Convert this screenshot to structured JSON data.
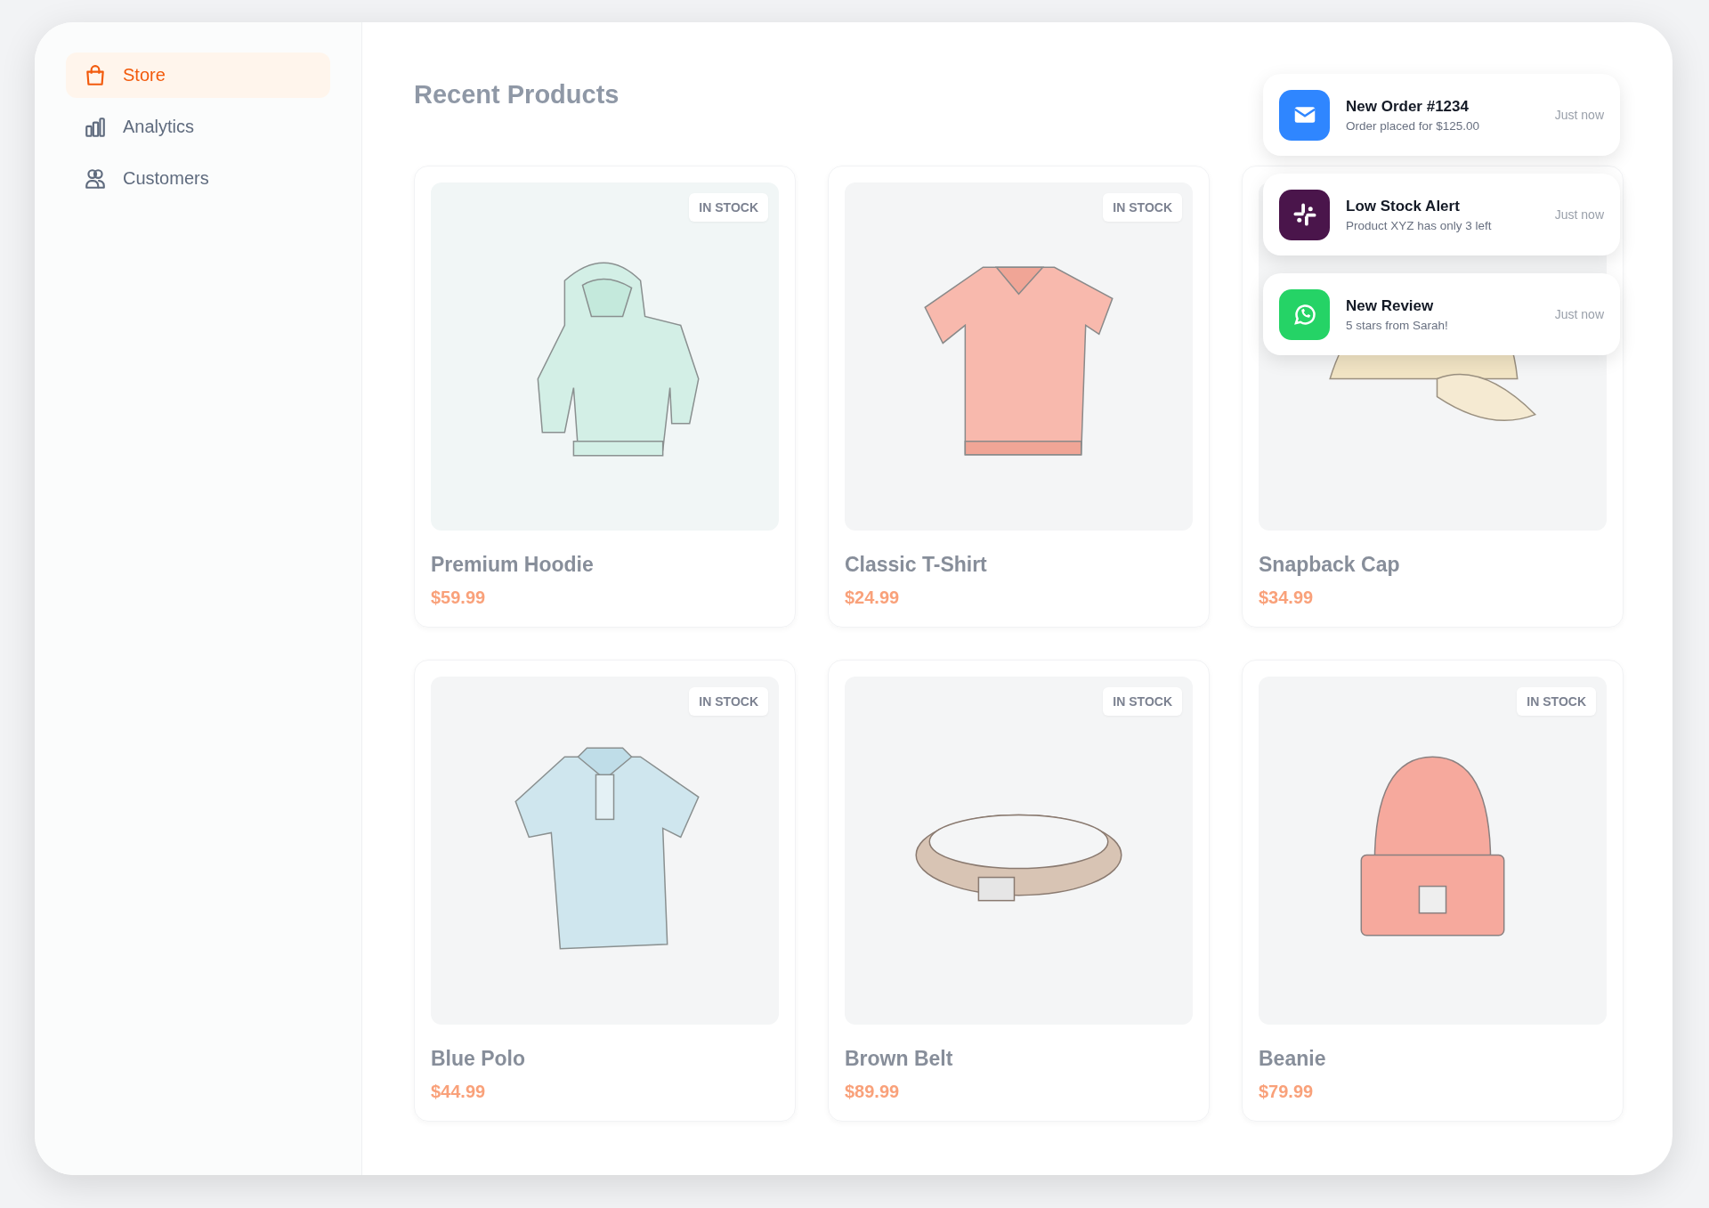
{
  "sidebar": {
    "items": [
      {
        "label": "Store",
        "kind": "bag",
        "selected": true
      },
      {
        "label": "Analytics",
        "kind": "chart",
        "selected": false
      },
      {
        "label": "Customers",
        "kind": "users",
        "selected": false
      }
    ]
  },
  "main": {
    "title": "Recent Products",
    "products": [
      {
        "name": "Premium Hoodie",
        "price": "$59.99",
        "badge": "IN STOCK"
      },
      {
        "name": "Classic T-Shirt",
        "price": "$24.99",
        "badge": "IN STOCK"
      },
      {
        "name": "Snapback Cap",
        "price": "$34.99"
      },
      {
        "name": "Blue Polo",
        "price": "$44.99",
        "badge": "IN STOCK"
      },
      {
        "name": "Brown Belt",
        "price": "$89.99",
        "badge": "IN STOCK"
      },
      {
        "name": "Beanie",
        "price": "$79.99",
        "badge": "IN STOCK"
      }
    ]
  },
  "notifications": [
    {
      "title": "New Order #1234",
      "message": "Order placed for $125.00",
      "time": "Just now",
      "kind": "mail",
      "color": "#2f86ff"
    },
    {
      "title": "Low Stock Alert",
      "message": "Product XYZ has only 3 left",
      "time": "Just now",
      "kind": "hash",
      "color": "#4a154b"
    },
    {
      "title": "New Review",
      "message": "5 stars from Sarah!",
      "time": "Just now",
      "kind": "chat",
      "color": "#25d366"
    }
  ]
}
